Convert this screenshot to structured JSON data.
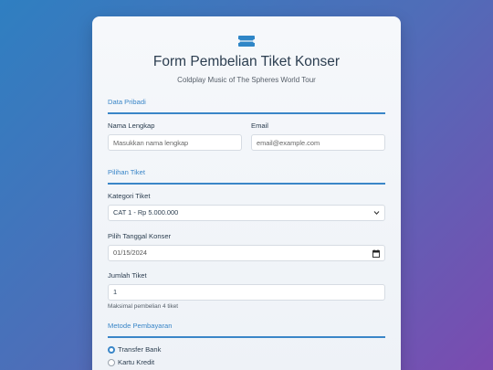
{
  "form": {
    "title": "Form Pembelian Tiket Konser",
    "subtitle": "Coldplay Music of The Spheres World Tour"
  },
  "sections": {
    "personal": "Data Pribadi",
    "ticket": "Pilihan Tiket",
    "payment": "Metode Pembayaran"
  },
  "fields": {
    "name_label": "Nama Lengkap",
    "name_placeholder": "Masukkan nama lengkap",
    "email_label": "Email",
    "email_placeholder": "email@example.com",
    "category_label": "Kategori Tiket",
    "category_value": "CAT 1 - Rp 5.000.000",
    "date_label": "Pilih Tanggal Konser",
    "date_value": "01/15/2024",
    "qty_label": "Jumlah Tiket",
    "qty_value": "1",
    "qty_hint": "Maksimal pembelian 4 tiket"
  },
  "payment": {
    "options": [
      "Transfer Bank",
      "Kartu Kredit"
    ],
    "selected": "Transfer Bank"
  },
  "colors": {
    "accent": "#3a86c8",
    "title": "#2c3e50"
  },
  "icons": {
    "logo": "ticket-icon",
    "select": "chevron-down-icon",
    "date": "calendar-icon"
  }
}
